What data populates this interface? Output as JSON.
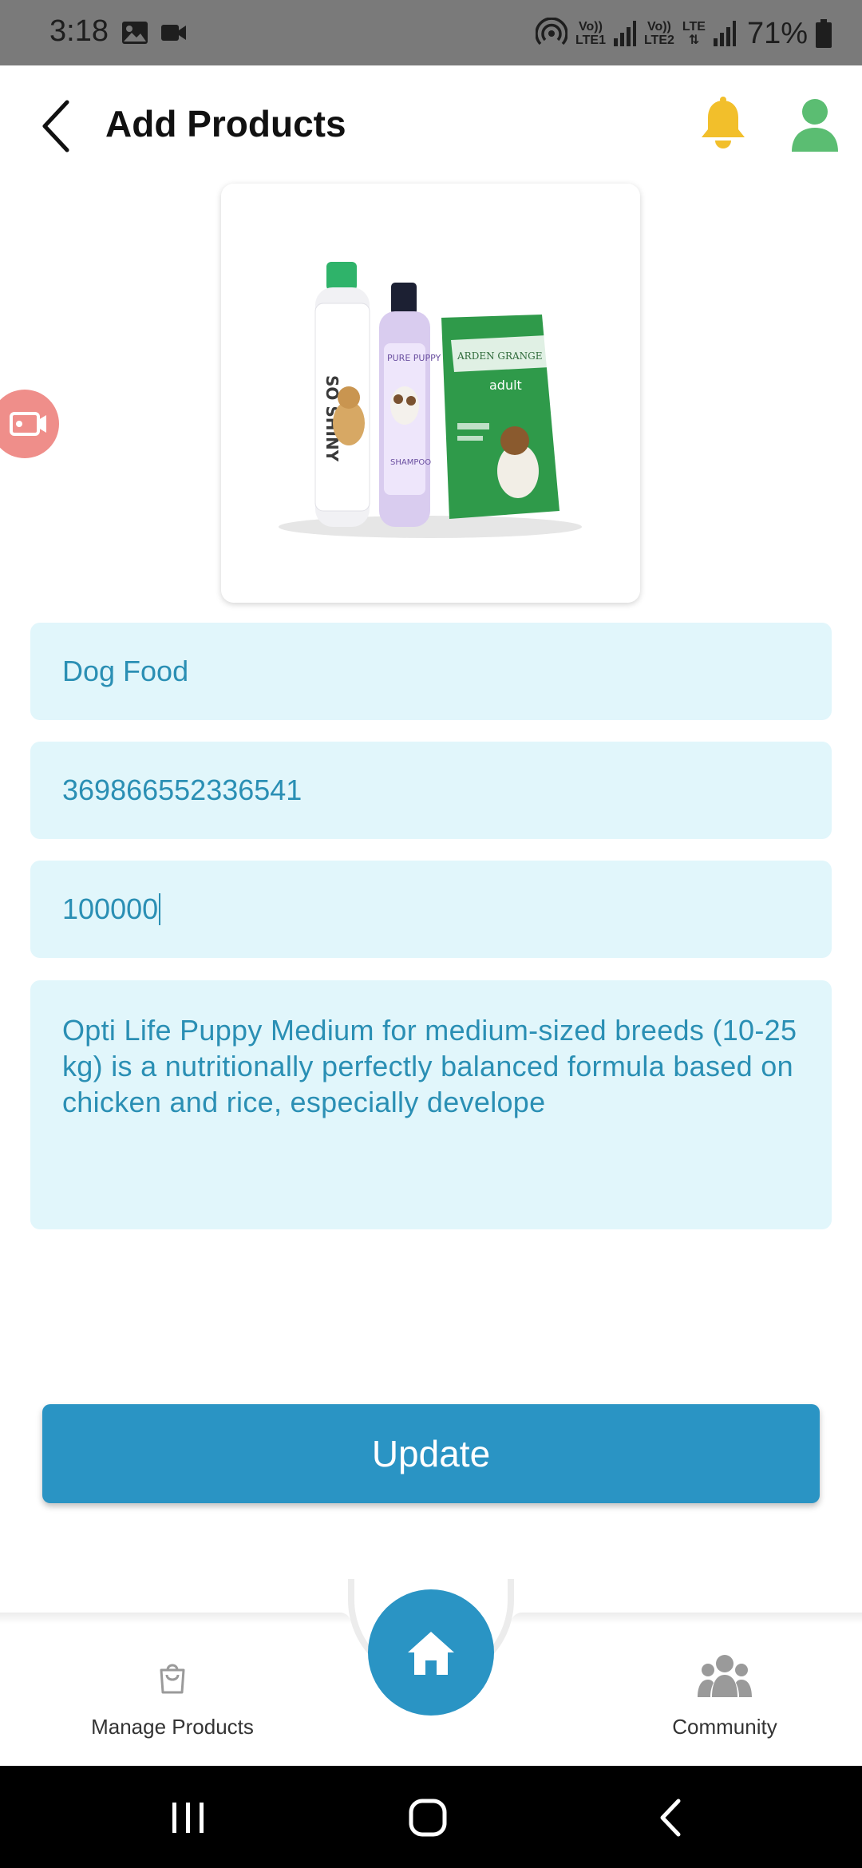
{
  "status_bar": {
    "time": "3:18",
    "sim1_top": "Vo))",
    "sim1_bottom": "LTE1",
    "sim2_top": "Vo))",
    "sim2_bottom": "LTE2",
    "network_type": "LTE",
    "battery": "71%",
    "icons": [
      "gallery-icon",
      "video-icon",
      "hotspot-icon",
      "signal-icon",
      "battery-icon"
    ]
  },
  "header": {
    "title": "Add Products",
    "icons": [
      "back-arrow-icon",
      "bell-icon",
      "user-icon"
    ],
    "accent_bell": "#f2bf2b",
    "accent_user": "#5bbd72"
  },
  "product_image": {
    "label": "pet products photo",
    "items": [
      "shampoo bottle",
      "puppy shampoo bottle",
      "dog food bag"
    ]
  },
  "form": {
    "name_value": "Dog Food",
    "code_value": "369866552336541",
    "price_value": "100000",
    "description_value": "Opti Life Puppy Medium for medium-sized breeds (10-25 kg) is a nutritionally perfectly balanced formula based on chicken and rice, especially develope",
    "field_bg": "#e1f6fb",
    "field_text_color": "#2a8fb4"
  },
  "actions": {
    "update_label": "Update",
    "primary_color": "#2a94c4"
  },
  "bottom_nav": {
    "manage_label": "Manage Products",
    "community_label": "Community",
    "icons": [
      "shopping-bag-icon",
      "home-icon",
      "people-icon"
    ]
  },
  "system_nav": {
    "icons": [
      "recents-icon",
      "home-circle-icon",
      "back-icon"
    ]
  }
}
